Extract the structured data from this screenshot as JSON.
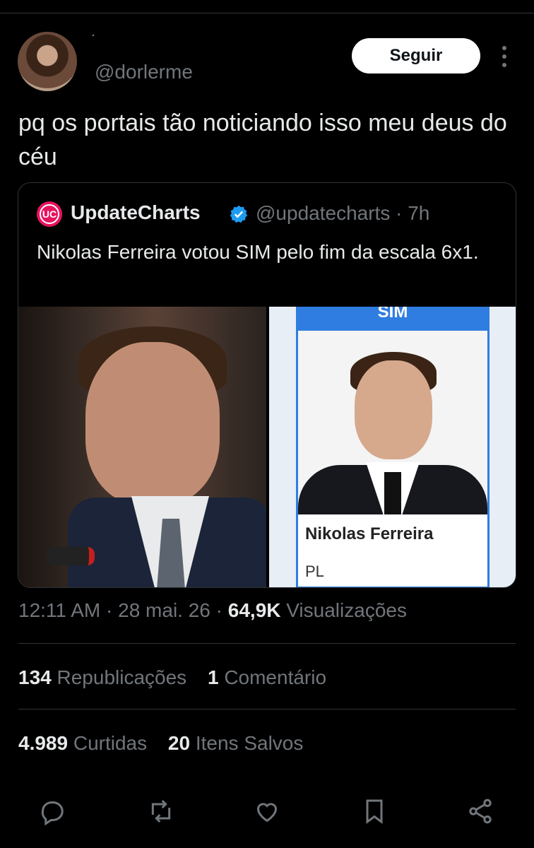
{
  "author": {
    "display_name": "´",
    "handle": "@dorlerme",
    "follow_label": "Seguir"
  },
  "tweet": {
    "text": "pq os portais tão noticiando isso meu deus do céu"
  },
  "quote": {
    "logo_text": "UC",
    "name": "UpdateCharts",
    "handle": "@updatecharts",
    "separator": "·",
    "age": "7h",
    "text": "Nikolas Ferreira votou SIM pelo fim da escala 6x1.",
    "card": {
      "band_label": "SIM",
      "person_name": "Nikolas Ferreira",
      "party": "PL"
    }
  },
  "meta": {
    "time": "12:11 AM",
    "date": "28 mai. 26",
    "views_count": "64,9K",
    "views_label": "Visualizações"
  },
  "stats": {
    "reposts_count": "134",
    "reposts_label": "Republicações",
    "comments_count": "1",
    "comments_label": "Comentário",
    "likes_count": "4.989",
    "likes_label": "Curtidas",
    "saves_count": "20",
    "saves_label": "Itens Salvos"
  },
  "icons": {
    "more": "more-vertical-icon",
    "verified": "verified-badge-icon",
    "reply": "reply-icon",
    "repost": "repost-icon",
    "like": "heart-icon",
    "bookmark": "bookmark-icon",
    "share": "share-icon"
  },
  "colors": {
    "background": "#000000",
    "text": "#e7e9ea",
    "muted": "#71767b",
    "divider": "#2f3336",
    "verified": "#1d9bf0",
    "brand": "#e8135f"
  }
}
